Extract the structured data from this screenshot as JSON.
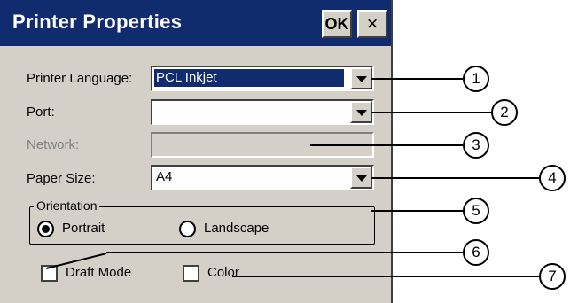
{
  "window": {
    "title": "Printer Properties",
    "ok_label": "OK",
    "close_label": "×"
  },
  "form": {
    "printer_language": {
      "label": "Printer Language:",
      "value": "PCL Inkjet"
    },
    "port": {
      "label": "Port:",
      "value": ""
    },
    "network": {
      "label": "Network:",
      "value": ""
    },
    "paper_size": {
      "label": "Paper Size:",
      "value": "A4"
    },
    "orientation": {
      "title": "Orientation",
      "options": [
        {
          "label": "Portrait",
          "selected": true
        },
        {
          "label": "Landscape",
          "selected": false
        }
      ]
    },
    "draft_mode": {
      "label": "Draft Mode",
      "checked": false
    },
    "color": {
      "label": "Color",
      "checked": false
    }
  },
  "callouts": [
    "1",
    "2",
    "3",
    "4",
    "5",
    "6",
    "7"
  ]
}
